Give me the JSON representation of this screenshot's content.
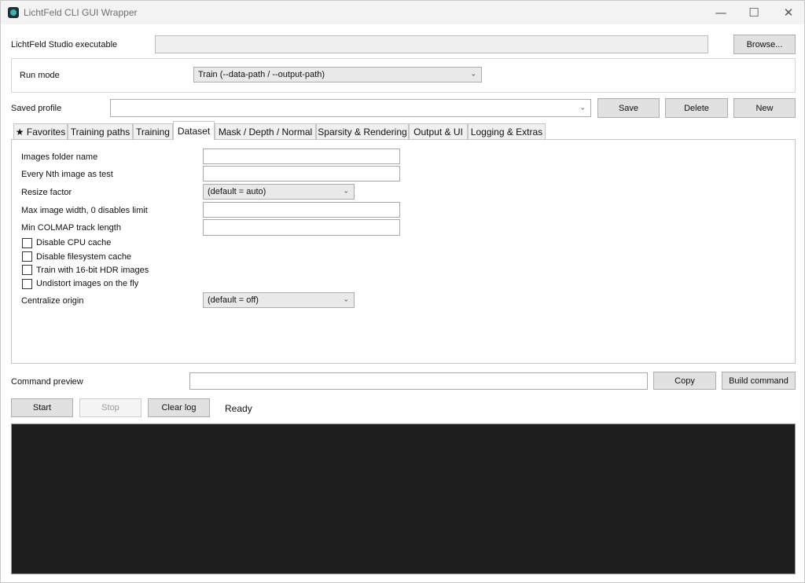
{
  "window": {
    "title": "LichtFeld CLI GUI Wrapper",
    "minimize_glyph": "—",
    "maximize_glyph": "☐",
    "close_glyph": "✕"
  },
  "executable": {
    "label": "LichtFeld Studio executable",
    "value": "",
    "browse_label": "Browse..."
  },
  "run_mode": {
    "label": "Run mode",
    "selected": "Train (--data-path / --output-path)"
  },
  "profile": {
    "label": "Saved profile",
    "selected": "",
    "save_label": "Save",
    "delete_label": "Delete",
    "new_label": "New"
  },
  "tabs": [
    {
      "label": "★ Favorites",
      "active": false
    },
    {
      "label": "Training paths",
      "active": false
    },
    {
      "label": "Training",
      "active": false
    },
    {
      "label": "Dataset",
      "active": true
    },
    {
      "label": "Mask / Depth / Normal",
      "active": false
    },
    {
      "label": "Sparsity & Rendering",
      "active": false
    },
    {
      "label": "Output & UI",
      "active": false
    },
    {
      "label": "Logging & Extras",
      "active": false
    }
  ],
  "dataset": {
    "images_folder": {
      "label": "Images folder name",
      "value": ""
    },
    "every_nth": {
      "label": "Every Nth image as test",
      "value": ""
    },
    "resize_factor": {
      "label": "Resize factor",
      "selected": "(default = auto)"
    },
    "max_width": {
      "label": "Max image width, 0 disables limit",
      "value": ""
    },
    "min_track": {
      "label": "Min COLMAP track length",
      "value": ""
    },
    "checkboxes": [
      {
        "label": "Disable CPU cache",
        "checked": false
      },
      {
        "label": "Disable filesystem cache",
        "checked": false
      },
      {
        "label": "Train with 16-bit HDR images",
        "checked": false
      },
      {
        "label": "Undistort images on the fly",
        "checked": false
      }
    ],
    "centralize_origin": {
      "label": "Centralize origin",
      "selected": "(default = off)"
    }
  },
  "command": {
    "label": "Command preview",
    "value": "",
    "copy_label": "Copy",
    "build_label": "Build command"
  },
  "controls": {
    "start_label": "Start",
    "stop_label": "Stop",
    "clear_label": "Clear log",
    "status": "Ready"
  },
  "colors": {
    "log_background": "#1e1e1e",
    "titlebar": "#f3f3f3",
    "button": "#e1e1e1"
  }
}
